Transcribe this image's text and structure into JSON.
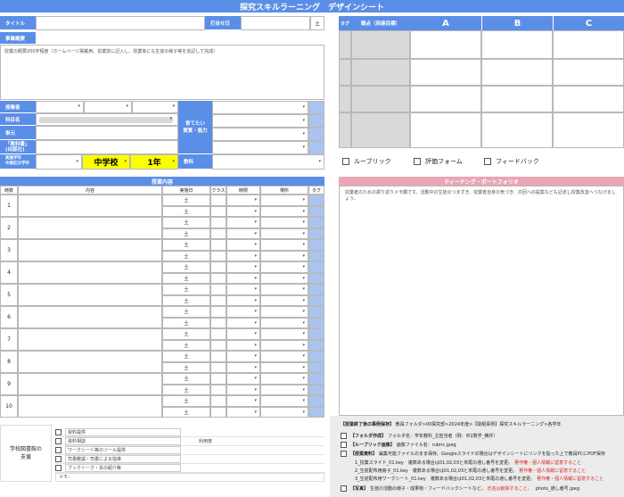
{
  "title": "探究スキルラーニング　デザインシート",
  "top": {
    "title_label": "タイトル",
    "date_label": "打合せ日",
    "day_value": "土",
    "overview_label": "事業概要",
    "overview_placeholder": "授業の概要200字程度（ホームページ掲載用。授業前に記入し、授業後にも生徒の様子等を追記して完成）"
  },
  "left_form": {
    "teacher_label": "授業者",
    "subject_label": "科目名",
    "unit_label": "単元",
    "tag_label": "「教科書」\n(出版社)",
    "grade_label": "実施学年\n中高区分学年",
    "school_value": "中学校",
    "grade_value": "1年",
    "ability_label": "育てたい\n資質・能力",
    "textbook_label": "教科"
  },
  "rubric": {
    "tag_label": "タグ",
    "viewpoint_label": "観点（到達目標）",
    "cols": [
      "A",
      "B",
      "C"
    ]
  },
  "checkboxes": [
    "ルーブリック",
    "評価フォーム",
    "フィードバック"
  ],
  "lesson": {
    "header": "授業内容",
    "cols": [
      "時数",
      "内容",
      "実施日",
      "クラス",
      "時限",
      "場所",
      "タグ"
    ],
    "rows": [
      "1",
      "2",
      "3",
      "4",
      "5",
      "6",
      "7",
      "8",
      "9",
      "10"
    ],
    "day": "土"
  },
  "teaching": {
    "header": "ティーチング・ポートフォリオ",
    "note": "授業者のための振り返りメモ欄です。活動中の生徒のつまずき、授業者自身の気づき、次回への提案なども記述し授業改善へつなげましょう。"
  },
  "library": {
    "label": "学校図書館の\n支援",
    "items": [
      {
        "text": "資料提供",
        "extra": ""
      },
      {
        "text": "資料相談",
        "extra": "利用度"
      },
      {
        "text": "ワークシート等のツール提供",
        "extra": ""
      },
      {
        "text": "司書教諭・司書による指導",
        "extra": ""
      },
      {
        "text": "ブックトーク・本の紹介等",
        "extra": ""
      }
    ],
    "memo": "メモ："
  },
  "saving": {
    "heading": "【授業終了後の事例保存】",
    "heading_rest": "教員フォルダ>00探究部>2024年度>【取組事例】探究スキルラーニング>各学年",
    "rows": [
      {
        "bold": "【フォルダ作成】",
        "text": "フォルダ名：学年教科_主担当者（例：中2数学_横井）"
      },
      {
        "bold": "【ルーブリック画像】",
        "text": "画像ファイル名：rubric.jpeg"
      },
      {
        "bold": "【授業資料】",
        "text": "編集可能ファイルのまま保存。Googleスライドの場合はデザインシートにリンクを貼った上で教員PCにPDF保存"
      }
    ],
    "sub": [
      {
        "text": "1_授業スライド_01.key　複数ある場合は01,02,03と末尾の通し番号を変更。",
        "red": "著作権・個人情報に留意すること"
      },
      {
        "text": "2_生徒配布用冊子_01.key　複数ある場合は01,02,03と末尾の通し番号を変更。",
        "red": "著作権・個人情報に留意すること"
      },
      {
        "text": "3_生徒配布用ワークシート_01.key　複数ある場合は01,02,03と末尾の通し番号を変更。",
        "red": "著作権・個人情報に留意すること"
      }
    ],
    "photo": {
      "bold": "【写真】",
      "text": "生徒の活動の様子・成果物・フィードバックシートなど。",
      "red": "氏名は削除すること。",
      "tail": "photo_通し番号.jpeg"
    }
  },
  "colors": {
    "accent": "#5b8ee6",
    "pink": "#e9a6b6",
    "yellow": "#fbff00"
  }
}
